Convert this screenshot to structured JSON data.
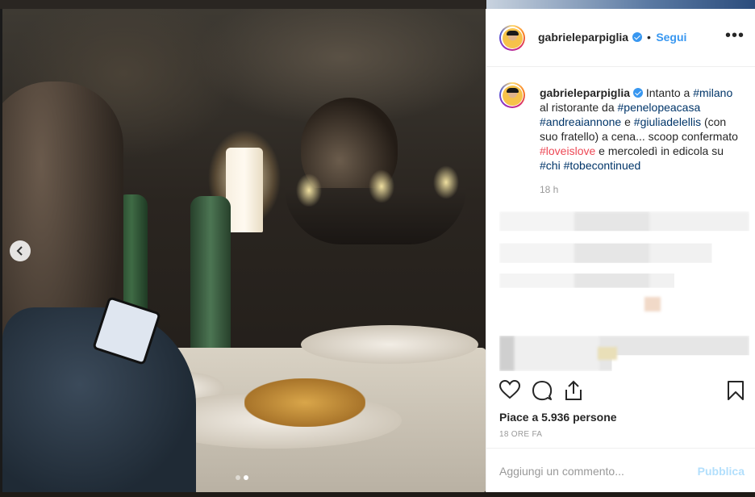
{
  "post": {
    "username": "gabrieleparpiglia",
    "separator": "•",
    "follow_label": "Segui",
    "more_label": "•••"
  },
  "caption": {
    "username": "gabrieleparpiglia",
    "t1": "Intanto a ",
    "h1": "#milano",
    "t2": " al ristorante da ",
    "h2": "#penelopeacasa",
    "h3": "#andreaiannone",
    "t3": " e ",
    "h4": "#giuliadelellis",
    "t4": " (con suo fratello) a cena... scoop confermato ",
    "h5": "#loveislove",
    "t5": " e mercoledì in edicola su ",
    "h6": "#chi",
    "t6": " ",
    "h7": "#tobecontinued",
    "time": "18 h"
  },
  "stats": {
    "likes_text": "Piace a 5.936 persone",
    "time_ago": "18 ORE FA"
  },
  "comment_box": {
    "placeholder": "Aggiungi un commento...",
    "publish_label": "Pubblica"
  },
  "carousel": {
    "count": 2,
    "active_index": 1
  },
  "colors": {
    "link": "#3897f0",
    "hashtag": "#003569",
    "hashtag_highlight": "#ed4956",
    "publish_disabled": "#b2dffc"
  },
  "icons": [
    "chevron-left-icon",
    "verified-icon",
    "more-icon",
    "heart-icon",
    "comment-icon",
    "share-icon",
    "bookmark-icon"
  ]
}
